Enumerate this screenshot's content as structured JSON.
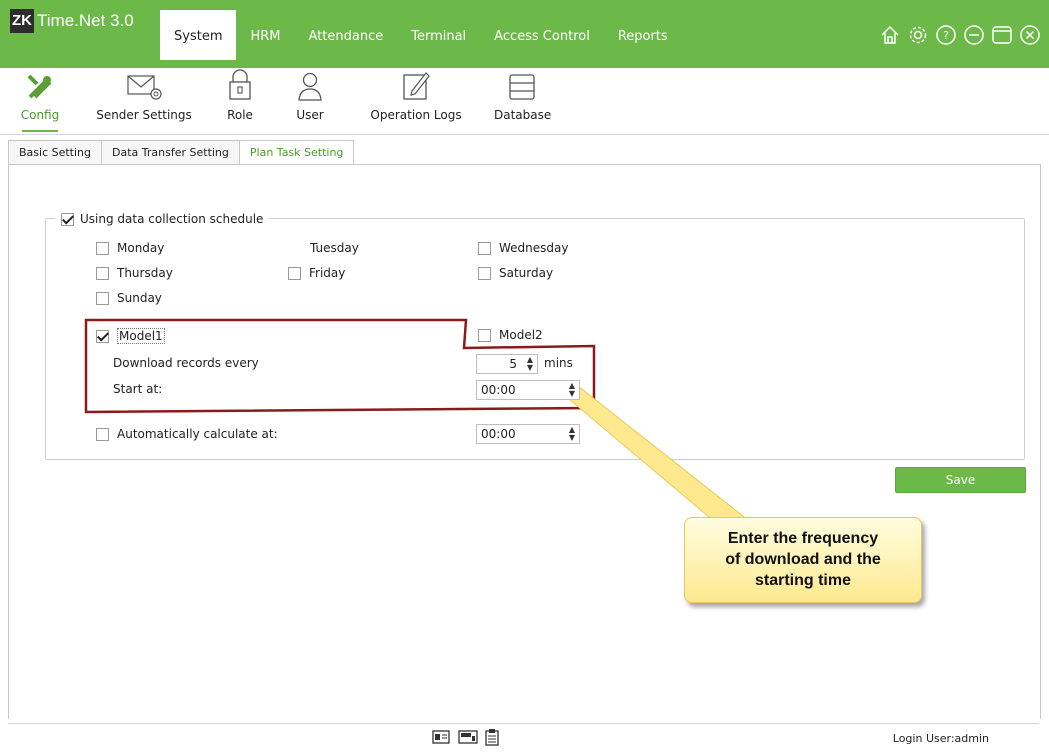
{
  "app": {
    "logo_badge": "ZK",
    "logo_name": "Time.Net 3.0"
  },
  "menu": [
    {
      "label": "System",
      "active": true
    },
    {
      "label": "HRM"
    },
    {
      "label": "Attendance"
    },
    {
      "label": "Terminal"
    },
    {
      "label": "Access Control"
    },
    {
      "label": "Reports"
    }
  ],
  "window_icons": [
    "home-icon",
    "gear-icon",
    "help-icon",
    "minimize-icon",
    "maximize-icon",
    "close-icon"
  ],
  "toolbar": {
    "config": "Config",
    "sender_settings": "Sender Settings",
    "role": "Role",
    "user": "User",
    "operation_logs": "Operation Logs",
    "database": "Database"
  },
  "tabs": {
    "basic": "Basic Setting",
    "transfer": "Data Transfer Setting",
    "plan": "Plan Task Setting"
  },
  "schedule": {
    "title": "Using data collection schedule",
    "title_checked": true,
    "days": {
      "monday": "Monday",
      "tuesday": "Tuesday",
      "wednesday": "Wednesday",
      "thursday": "Thursday",
      "friday": "Friday",
      "saturday": "Saturday",
      "sunday": "Sunday"
    },
    "model1": "Model1",
    "model1_checked": true,
    "model2": "Model2",
    "download_label": "Download records every",
    "download_value": "5",
    "download_unit": "mins",
    "start_label": "Start at:",
    "start_value": "00:00",
    "auto_calc_label": "Automatically calculate at:",
    "auto_calc_value": "00:00"
  },
  "save_label": "Save",
  "callout": {
    "line1": "Enter the frequency",
    "line2": "of download and the",
    "line3": "starting time"
  },
  "status": {
    "login": "Login User:admin"
  },
  "colors": {
    "brand": "#6cb949",
    "annotation_box": "#8b1a1a",
    "callout": "#ffe98f"
  }
}
